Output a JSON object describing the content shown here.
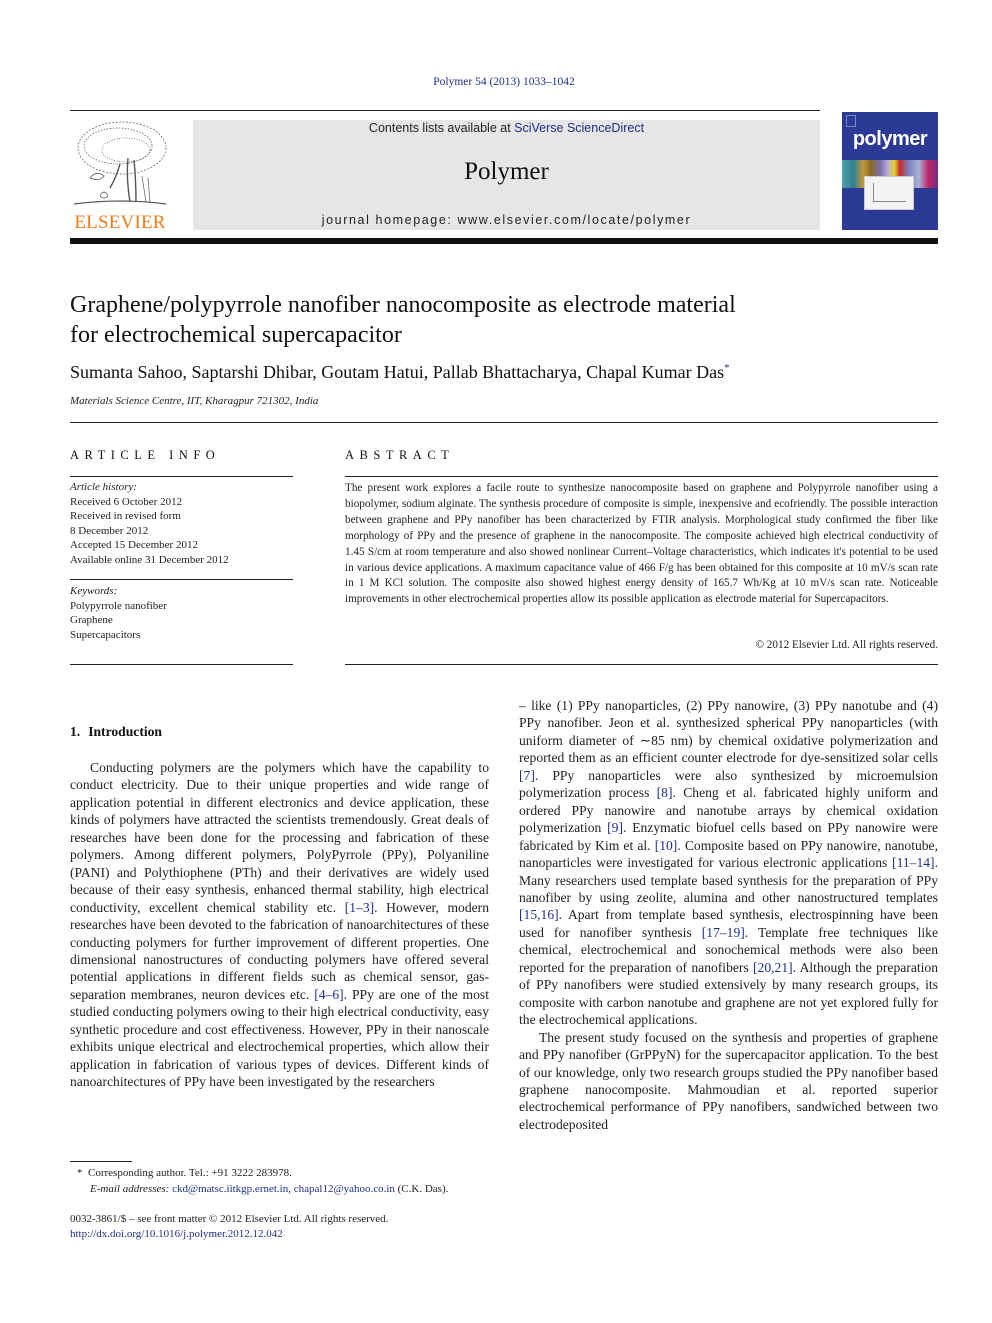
{
  "citation": "Polymer 54 (2013) 1033–1042",
  "header": {
    "publisher_logo_text": "ELSEVIER",
    "contents_prefix": "Contents lists available at ",
    "contents_link": "SciVerse ScienceDirect",
    "journal_title": "Polymer",
    "homepage": "journal homepage: www.elsevier.com/locate/polymer",
    "cover_title": "polymer",
    "colors": {
      "elsevier_orange": "#f07d1a",
      "cover_blue": "#2b3a95",
      "link_blue": "#1f2f8a",
      "banner_gray": "#e6e6e6"
    }
  },
  "article": {
    "title_line1": "Graphene/polypyrrole nanofiber nanocomposite as electrode material",
    "title_line2": "for electrochemical supercapacitor",
    "authors": "Sumanta Sahoo, Saptarshi Dhibar, Goutam Hatui, Pallab Bhattacharya, Chapal Kumar Das",
    "corresponding_mark": "*",
    "affiliation": "Materials Science Centre, IIT, Kharagpur 721302, India"
  },
  "article_info": {
    "heading": "ARTICLE INFO",
    "history_label": "Article history:",
    "history": [
      "Received 6 October 2012",
      "Received in revised form",
      "8 December 2012",
      "Accepted 15 December 2012",
      "Available online 31 December 2012"
    ],
    "keywords_label": "Keywords:",
    "keywords": [
      "Polypyrrole nanofiber",
      "Graphene",
      "Supercapacitors"
    ]
  },
  "abstract": {
    "heading": "ABSTRACT",
    "text": "The present work explores a facile route to synthesize nanocomposite based on graphene and Poly­pyrrole nanofiber using a biopolymer, sodium alginate. The synthesis procedure of composite is simple, inexpensive and ecofriendly. The possible interaction between graphene and PPy nanofiber has been characterized by FTIR analysis. Morphological study confirmed the fiber like morphology of PPy and the presence of graphene in the nanocomposite. The composite achieved high electrical conductivity of 1.45 S/cm at room temperature and also showed nonlinear Current–Voltage characteristics, which in­dicates it's potential to be used in various device applications. A maximum capacitance value of 466 F/g has been obtained for this composite at 10 mV/s scan rate in 1 M KCl solution. The composite also showed highest energy density of 165.7 Wh/Kg at 10 mV/s scan rate. Noticeable improvements in other electrochemical properties allow its possible application as electrode material for Supercapacitors.",
    "copyright": "© 2012 Elsevier Ltd. All rights reserved."
  },
  "introduction": {
    "section_number": "1.",
    "section_title": "Introduction",
    "left_p1": [
      {
        "t": "Conducting polymers are the polymers which have the capability to conduct electricity. Due to their unique properties and wide range of application potential in different electronics and device applica­tion, these kinds of polymers have attracted the scientists tremen­dously. Great deals of researches have been done for the processing and fabrication of these polymers. Among different polymers, Pol­yPyrrole (PPy), Polyaniline (PANI) and Polythiophene (PTh) and their derivatives are widely used because of their easy synthesis, enhanced thermal stability, high electrical conductivity, excellent chemical stability etc. "
      },
      {
        "ref": "[1–3]"
      },
      {
        "t": ". However, modern researches have been devoted to the fabrication of nanoarchitectures of these con­ducting polymers for further improvement of different properties. One dimensional nanostructures of conducting polymers have offered several potential applications in different fields such as chemical sensor, gas-separation membranes, neuron devices etc. "
      },
      {
        "ref": "[4–6]"
      },
      {
        "t": ". PPy are one of the most studied conducting polymers owing to their high electrical conductivity, easy synthetic procedure and cost effectiveness. However, PPy in their nanoscale exhibits unique electrical and electrochemical properties, which allow their appli­cation in fabrication of various types of devices. Different kinds of nanoarchitectures of PPy have been investigated by the researchers"
      }
    ],
    "right_p1": [
      {
        "t": "– like (1) PPy nanoparticles, (2) PPy nanowire, (3) PPy nanotube and (4) PPy nanofiber. Jeon et al. synthesized spherical PPy nanoparticles (with uniform diameter of ∼85 nm) by chemical oxidative poly­merization and reported them as an efficient counter electrode for dye-sensitized solar cells "
      },
      {
        "ref": "[7]"
      },
      {
        "t": ". PPy nanoparticles were also synthe­sized by microemulsion polymerization process "
      },
      {
        "ref": "[8]"
      },
      {
        "t": ". Cheng et al. fabricated highly uniform and ordered PPy nanowire and nanotube arrays by chemical oxidation polymerization "
      },
      {
        "ref": "[9]"
      },
      {
        "t": ". Enzymatic biofuel cells based on PPy nanowire were fabricated by Kim et al. "
      },
      {
        "ref": "[10]"
      },
      {
        "t": ". Composite based on PPy nanowire, nanotube, nanoparticles were investigated for various electronic applications "
      },
      {
        "ref": "[11–14]"
      },
      {
        "t": ". Many re­searchers used template based synthesis for the preparation of PPy nanofiber by using zeolite, alumina and other nanostructured tem­plates "
      },
      {
        "ref": "[15,16]"
      },
      {
        "t": ". Apart from template based synthesis, electrospinning have been used for nanofiber synthesis "
      },
      {
        "ref": "[17–19]"
      },
      {
        "t": ". Template free techniques like chemical, electrochemical and sonochemical methods were also been reported for the preparation of nanofibers "
      },
      {
        "ref": "[20,21]"
      },
      {
        "t": ". Although the preparation of PPy nanofibers were studied extensively by many research groups, its composite with carbon nanotube and graphene are not yet explored fully for the electro­chemical applications."
      }
    ],
    "right_p2": "The present study focused on the synthesis and properties of graphene and PPy nanofiber (GrPPyN) for the supercapacitor application. To the best of our knowledge, only two research groups studied the PPy nanofiber based graphene nanocomposite. Mah­moudian et al. reported superior electrochemical performance of PPy nanofibers, sandwiched between two electrodeposited"
  },
  "footnote": {
    "mark": "*",
    "corresponding": "Corresponding author. Tel.: +91 3222 283978.",
    "email_label": "E-mail addresses:",
    "email1": "ckd@matsc.iitkgp.ernet.in",
    "email2": "chapal12@yahoo.co.in",
    "email_suffix": " (C.K. Das)."
  },
  "front_matter": {
    "issn_line": "0032-3861/$ – see front matter © 2012 Elsevier Ltd. All rights reserved.",
    "doi": "http://dx.doi.org/10.1016/j.polymer.2012.12.042"
  }
}
